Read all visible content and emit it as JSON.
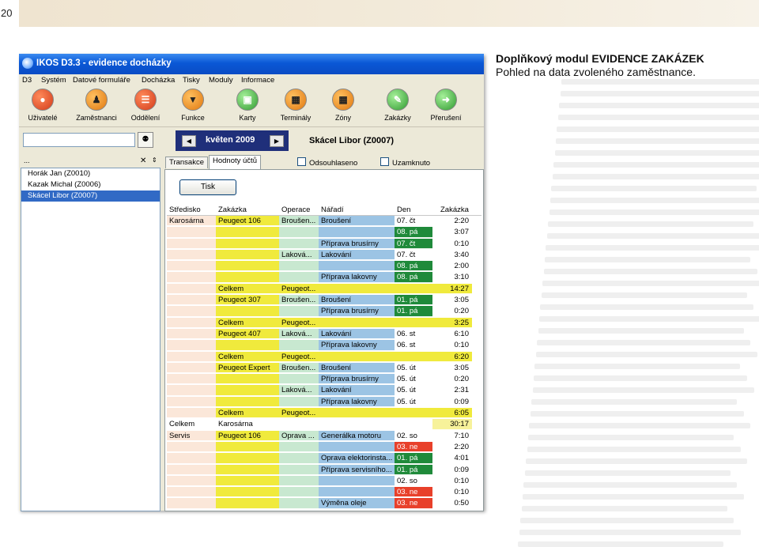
{
  "page_number": "20",
  "heading": {
    "title": "Doplňkový modul EVIDENCE ZAKÁZEK",
    "subtitle": "Pohled na data zvoleného zaměstnance."
  },
  "window": {
    "title": "IKOS D3.3 - evidence docházky",
    "menu": [
      "D3",
      "Systém",
      "Datové formuláře",
      "Docházka",
      "Tisky",
      "Moduly",
      "Informace"
    ],
    "toolbar": [
      "Uživatelé",
      "Zaměstnanci",
      "Oddělení",
      "Funkce",
      "Karty",
      "Terminály",
      "Zóny",
      "Zakázky",
      "Přerušení"
    ],
    "period": "květen 2009",
    "employee_name": "Skácel Libor (Z0007)",
    "list_header": "...",
    "employees": [
      "Horák Jan (Z0010)",
      "Kazak Michal (Z0006)",
      "Skácel Libor (Z0007)"
    ],
    "tabs": [
      "Transakce",
      "Hodnoty účtů"
    ],
    "checkboxes": [
      "Odsouhlaseno",
      "Uzamknuto"
    ],
    "print_button": "Tisk",
    "columns": [
      "Středisko",
      "Zakázka",
      "Operace",
      "Nářadí",
      "Den",
      "Zakázka"
    ],
    "rows": [
      [
        "Karosárna",
        "Peugeot 106",
        "Broušen...",
        "Broušení",
        "07. čt",
        "2:20"
      ],
      [
        "",
        "",
        "",
        "",
        "08. pá",
        "3:07"
      ],
      [
        "",
        "",
        "",
        "Příprava brusírny",
        "07. čt",
        "0:10"
      ],
      [
        "",
        "",
        "Laková...",
        "Lakování",
        "07. čt",
        "3:40"
      ],
      [
        "",
        "",
        "",
        "",
        "08. pá",
        "2:00"
      ],
      [
        "",
        "",
        "",
        "Příprava lakovny",
        "08. pá",
        "3:10"
      ],
      [
        "",
        "Celkem",
        "Peugeot...",
        "",
        "",
        "14:27"
      ],
      [
        "",
        "Peugeot 307",
        "Broušen...",
        "Broušení",
        "01. pá",
        "3:05"
      ],
      [
        "",
        "",
        "",
        "Příprava brusírny",
        "01. pá",
        "0:20"
      ],
      [
        "",
        "Celkem",
        "Peugeot...",
        "",
        "",
        "3:25"
      ],
      [
        "",
        "Peugeot 407",
        "Laková...",
        "Lakování",
        "06. st",
        "6:10"
      ],
      [
        "",
        "",
        "",
        "Příprava lakovny",
        "06. st",
        "0:10"
      ],
      [
        "",
        "Celkem",
        "Peugeot...",
        "",
        "",
        "6:20"
      ],
      [
        "",
        "Peugeot Expert",
        "Broušen...",
        "Broušení",
        "05. út",
        "3:05"
      ],
      [
        "",
        "",
        "",
        "Příprava brusírny",
        "05. út",
        "0:20"
      ],
      [
        "",
        "",
        "Laková...",
        "Lakování",
        "05. út",
        "2:31"
      ],
      [
        "",
        "",
        "",
        "Příprava lakovny",
        "05. út",
        "0:09"
      ],
      [
        "",
        "Celkem",
        "Peugeot...",
        "",
        "",
        "6:05"
      ],
      [
        "Celkem",
        "Karosárna",
        "",
        "",
        "",
        "30:17"
      ],
      [
        "Servis",
        "Peugeot 106",
        "Oprava ...",
        "Generálka motoru",
        "02. so",
        "7:10"
      ],
      [
        "",
        "",
        "",
        "",
        "03. ne",
        "2:20"
      ],
      [
        "",
        "",
        "",
        "Oprava elektorinsta...",
        "01. pá",
        "4:01"
      ],
      [
        "",
        "",
        "",
        "Příprava servisního...",
        "01. pá",
        "0:09"
      ],
      [
        "",
        "",
        "",
        "",
        "02. so",
        "0:10"
      ],
      [
        "",
        "",
        "",
        "",
        "03. ne",
        "0:10"
      ],
      [
        "",
        "",
        "",
        "Výměna oleje",
        "03. ne",
        "0:50"
      ]
    ],
    "row_types": [
      "n",
      "g",
      "g",
      "n",
      "g",
      "g",
      "t",
      "g",
      "g",
      "t",
      "n",
      "n",
      "t",
      "n",
      "n",
      "n",
      "n",
      "t",
      "s",
      "n",
      "r",
      "g",
      "g",
      "n",
      "r",
      "r"
    ],
    "colors": {
      "yellow": "#f0ea3c",
      "light_yellow": "#f7f29a",
      "operation": "#c8e8d0",
      "tool": "#9cc4e4",
      "green": "#1f8a3a",
      "red": "#e8402a",
      "peach": "#fbe7d9"
    }
  }
}
